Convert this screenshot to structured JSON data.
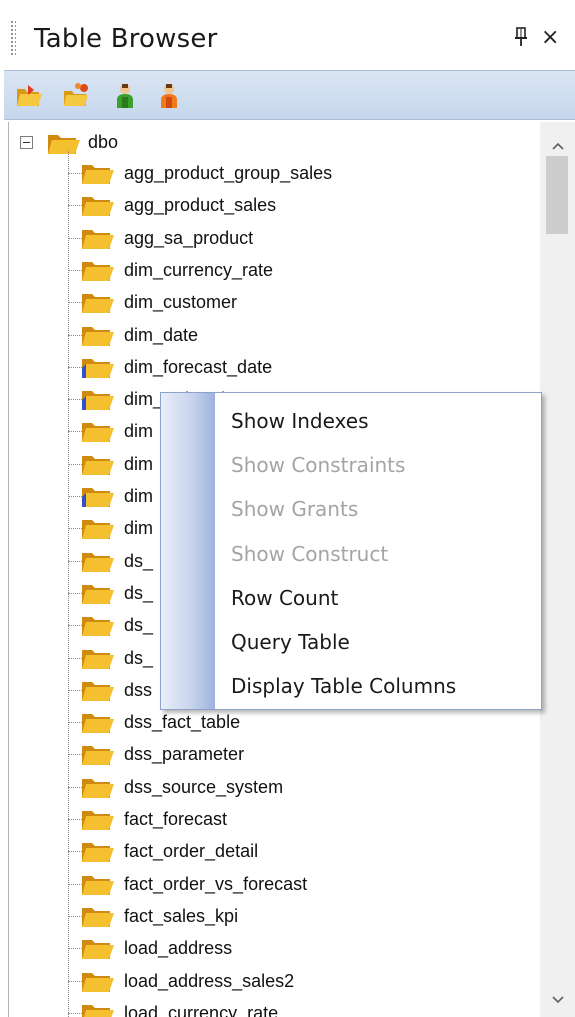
{
  "panel": {
    "title": "Table Browser"
  },
  "window_buttons": {
    "close": "×"
  },
  "toolbar": {
    "buttons": [
      {
        "icon": "open-folder-icon"
      },
      {
        "icon": "folder-group-icon"
      },
      {
        "icon": "user-green-icon"
      },
      {
        "icon": "user-orange-icon"
      }
    ]
  },
  "tree": {
    "root": {
      "label": "dbo",
      "expanded": true
    },
    "items": [
      {
        "label": "agg_product_group_sales"
      },
      {
        "label": "agg_product_sales"
      },
      {
        "label": "agg_sa_product"
      },
      {
        "label": "dim_currency_rate"
      },
      {
        "label": "dim_customer"
      },
      {
        "label": "dim_date"
      },
      {
        "label": "dim_forecast_date"
      },
      {
        "label": "dim_order_date"
      },
      {
        "label": "dim"
      },
      {
        "label": "dim"
      },
      {
        "label": "dim"
      },
      {
        "label": "dim"
      },
      {
        "label": "ds_"
      },
      {
        "label": "ds_"
      },
      {
        "label": "ds_"
      },
      {
        "label": "ds_"
      },
      {
        "label": "dss"
      },
      {
        "label": "dss_fact_table"
      },
      {
        "label": "dss_parameter"
      },
      {
        "label": "dss_source_system"
      },
      {
        "label": "fact_forecast"
      },
      {
        "label": "fact_order_detail"
      },
      {
        "label": "fact_order_vs_forecast"
      },
      {
        "label": "fact_sales_kpi"
      },
      {
        "label": "load_address"
      },
      {
        "label": "load_address_sales2"
      },
      {
        "label": "load_currency_rate"
      }
    ]
  },
  "context_menu": {
    "items": [
      {
        "label": "Show Indexes",
        "enabled": true
      },
      {
        "label": "Show Constraints",
        "enabled": false
      },
      {
        "label": "Show Grants",
        "enabled": false
      },
      {
        "label": "Show Construct",
        "enabled": false
      },
      {
        "label": "Row Count",
        "enabled": true
      },
      {
        "label": "Query Table",
        "enabled": true
      },
      {
        "label": "Display Table Columns",
        "enabled": true
      }
    ]
  },
  "colors": {
    "folder": "#f0b820",
    "folder_dark": "#d08a10",
    "folder_accent_blue": "#3050d0",
    "toolbar_bg": "#d2deef",
    "menu_border": "#8da2c8",
    "disabled_text": "#a4a4a4"
  }
}
